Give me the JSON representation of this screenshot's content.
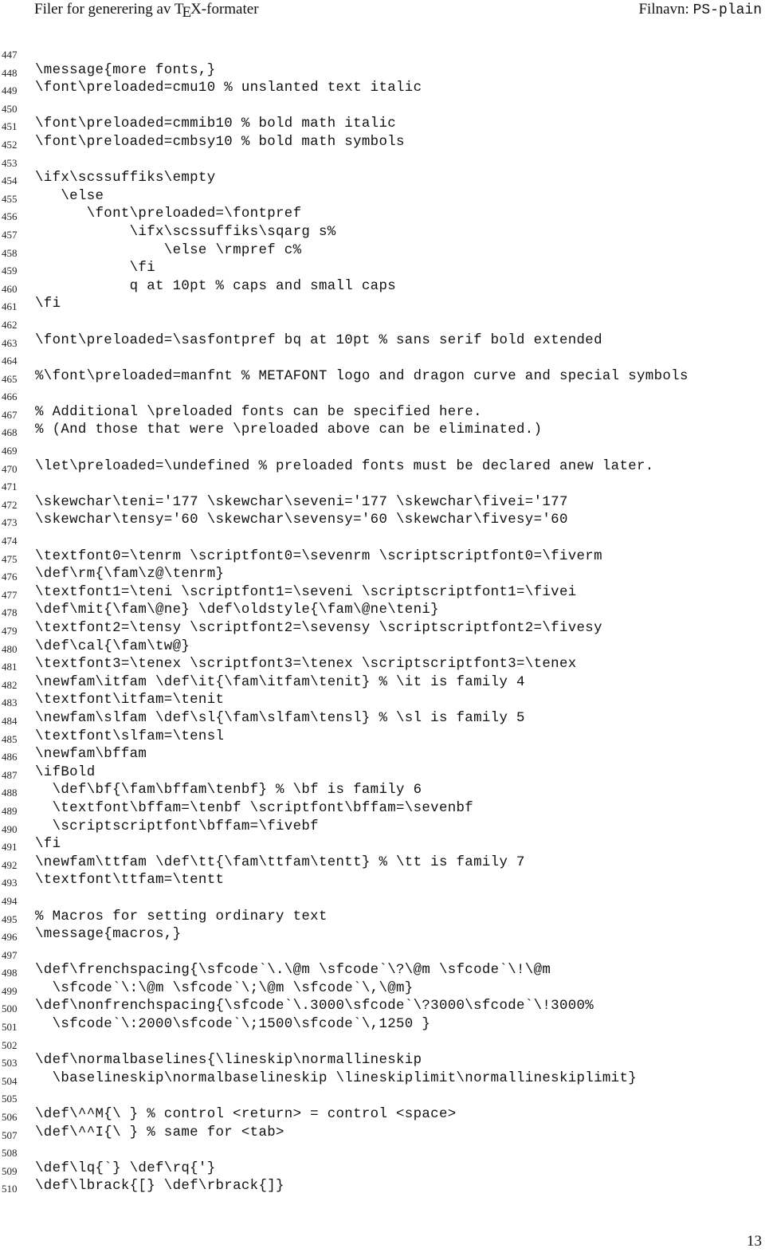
{
  "header": {
    "left_prefix": "Filer for generering av T",
    "left_tex_e": "E",
    "left_suffix": "X-formater",
    "right_label": "Filnavn: ",
    "right_filename": "PS-plain"
  },
  "listing": [
    {
      "n": "447",
      "code": ""
    },
    {
      "n": "448",
      "code": "\\message{more fonts,}"
    },
    {
      "n": "449",
      "code": "\\font\\preloaded=cmu10 % unslanted text italic"
    },
    {
      "n": "450",
      "code": ""
    },
    {
      "n": "451",
      "code": "\\font\\preloaded=cmmib10 % bold math italic"
    },
    {
      "n": "452",
      "code": "\\font\\preloaded=cmbsy10 % bold math symbols"
    },
    {
      "n": "453",
      "code": ""
    },
    {
      "n": "454",
      "code": "\\ifx\\scssuffiks\\empty"
    },
    {
      "n": "455",
      "code": "   \\else"
    },
    {
      "n": "456",
      "code": "      \\font\\preloaded=\\fontpref"
    },
    {
      "n": "457",
      "code": "           \\ifx\\scssuffiks\\sqarg s%"
    },
    {
      "n": "458",
      "code": "               \\else \\rmpref c%"
    },
    {
      "n": "459",
      "code": "           \\fi"
    },
    {
      "n": "460",
      "code": "           q at 10pt % caps and small caps"
    },
    {
      "n": "461",
      "code": "\\fi"
    },
    {
      "n": "462",
      "code": ""
    },
    {
      "n": "463",
      "code": "\\font\\preloaded=\\sasfontpref bq at 10pt % sans serif bold extended"
    },
    {
      "n": "464",
      "code": ""
    },
    {
      "n": "465",
      "code": "%\\font\\preloaded=manfnt % METAFONT logo and dragon curve and special symbols"
    },
    {
      "n": "466",
      "code": ""
    },
    {
      "n": "467",
      "code": "% Additional \\preloaded fonts can be specified here."
    },
    {
      "n": "468",
      "code": "% (And those that were \\preloaded above can be eliminated.)"
    },
    {
      "n": "469",
      "code": ""
    },
    {
      "n": "470",
      "code": "\\let\\preloaded=\\undefined % preloaded fonts must be declared anew later."
    },
    {
      "n": "471",
      "code": ""
    },
    {
      "n": "472",
      "code": "\\skewchar\\teni='177 \\skewchar\\seveni='177 \\skewchar\\fivei='177"
    },
    {
      "n": "473",
      "code": "\\skewchar\\tensy='60 \\skewchar\\sevensy='60 \\skewchar\\fivesy='60"
    },
    {
      "n": "474",
      "code": ""
    },
    {
      "n": "475",
      "code": "\\textfont0=\\tenrm \\scriptfont0=\\sevenrm \\scriptscriptfont0=\\fiverm"
    },
    {
      "n": "476",
      "code": "\\def\\rm{\\fam\\z@\\tenrm}"
    },
    {
      "n": "477",
      "code": "\\textfont1=\\teni \\scriptfont1=\\seveni \\scriptscriptfont1=\\fivei"
    },
    {
      "n": "478",
      "code": "\\def\\mit{\\fam\\@ne} \\def\\oldstyle{\\fam\\@ne\\teni}"
    },
    {
      "n": "479",
      "code": "\\textfont2=\\tensy \\scriptfont2=\\sevensy \\scriptscriptfont2=\\fivesy"
    },
    {
      "n": "480",
      "code": "\\def\\cal{\\fam\\tw@}"
    },
    {
      "n": "481",
      "code": "\\textfont3=\\tenex \\scriptfont3=\\tenex \\scriptscriptfont3=\\tenex"
    },
    {
      "n": "482",
      "code": "\\newfam\\itfam \\def\\it{\\fam\\itfam\\tenit} % \\it is family 4"
    },
    {
      "n": "483",
      "code": "\\textfont\\itfam=\\tenit"
    },
    {
      "n": "484",
      "code": "\\newfam\\slfam \\def\\sl{\\fam\\slfam\\tensl} % \\sl is family 5"
    },
    {
      "n": "485",
      "code": "\\textfont\\slfam=\\tensl"
    },
    {
      "n": "486",
      "code": "\\newfam\\bffam"
    },
    {
      "n": "487",
      "code": "\\ifBold"
    },
    {
      "n": "488",
      "code": "  \\def\\bf{\\fam\\bffam\\tenbf} % \\bf is family 6"
    },
    {
      "n": "489",
      "code": "  \\textfont\\bffam=\\tenbf \\scriptfont\\bffam=\\sevenbf"
    },
    {
      "n": "490",
      "code": "  \\scriptscriptfont\\bffam=\\fivebf"
    },
    {
      "n": "491",
      "code": "\\fi"
    },
    {
      "n": "492",
      "code": "\\newfam\\ttfam \\def\\tt{\\fam\\ttfam\\tentt} % \\tt is family 7"
    },
    {
      "n": "493",
      "code": "\\textfont\\ttfam=\\tentt"
    },
    {
      "n": "494",
      "code": ""
    },
    {
      "n": "495",
      "code": "% Macros for setting ordinary text"
    },
    {
      "n": "496",
      "code": "\\message{macros,}"
    },
    {
      "n": "497",
      "code": ""
    },
    {
      "n": "498",
      "code": "\\def\\frenchspacing{\\sfcode`\\.\\@m \\sfcode`\\?\\@m \\sfcode`\\!\\@m"
    },
    {
      "n": "499",
      "code": "  \\sfcode`\\:\\@m \\sfcode`\\;\\@m \\sfcode`\\,\\@m}"
    },
    {
      "n": "500",
      "code": "\\def\\nonfrenchspacing{\\sfcode`\\.3000\\sfcode`\\?3000\\sfcode`\\!3000%"
    },
    {
      "n": "501",
      "code": "  \\sfcode`\\:2000\\sfcode`\\;1500\\sfcode`\\,1250 }"
    },
    {
      "n": "502",
      "code": ""
    },
    {
      "n": "503",
      "code": "\\def\\normalbaselines{\\lineskip\\normallineskip"
    },
    {
      "n": "504",
      "code": "  \\baselineskip\\normalbaselineskip \\lineskiplimit\\normallineskiplimit}"
    },
    {
      "n": "505",
      "code": ""
    },
    {
      "n": "506",
      "code": "\\def\\^^M{\\ } % control <return> = control <space>"
    },
    {
      "n": "507",
      "code": "\\def\\^^I{\\ } % same for <tab>"
    },
    {
      "n": "508",
      "code": ""
    },
    {
      "n": "509",
      "code": "\\def\\lq{`} \\def\\rq{'}"
    },
    {
      "n": "510",
      "code": "\\def\\lbrack{[} \\def\\rbrack{]}"
    }
  ],
  "footer": {
    "page_number": "13"
  }
}
